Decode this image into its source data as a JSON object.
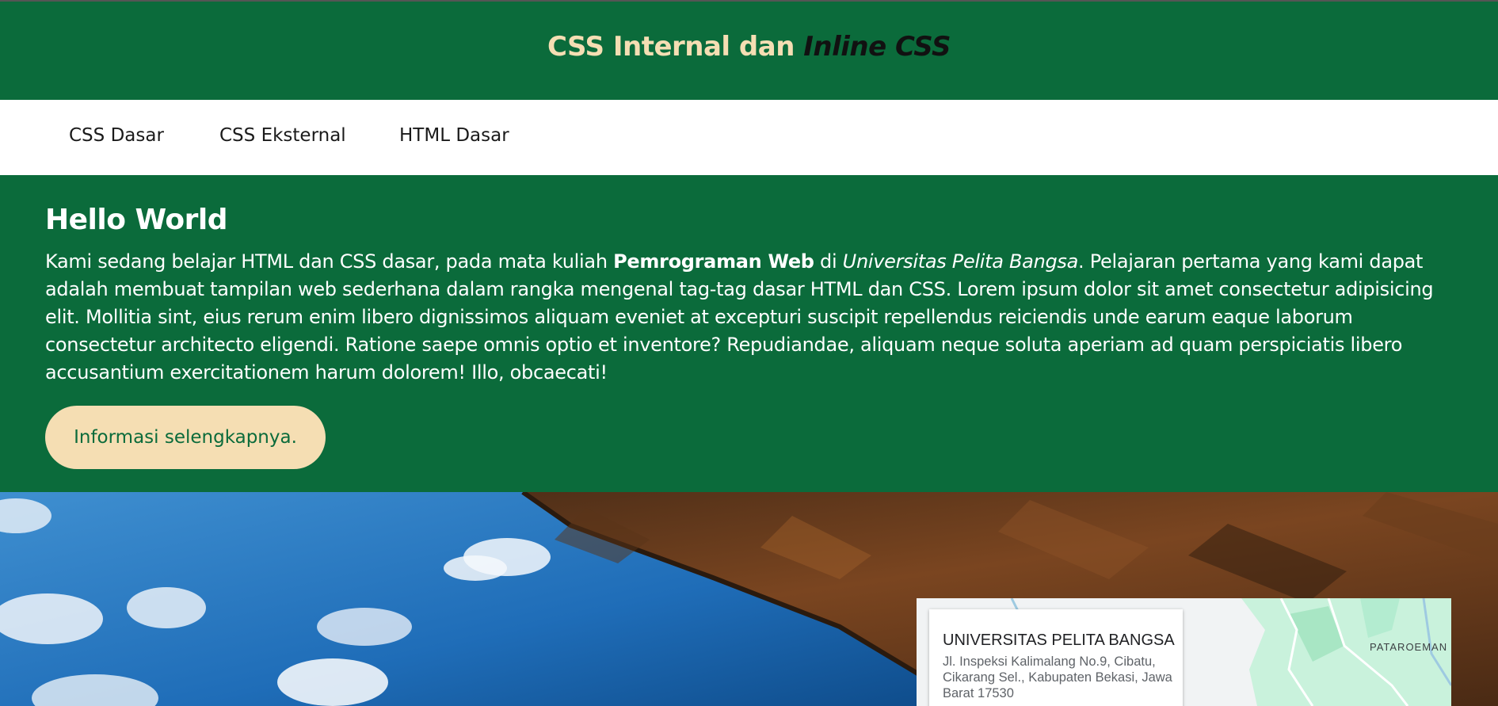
{
  "header": {
    "title_regular": "CSS Internal dan ",
    "title_emphasis": "Inline CSS"
  },
  "nav": {
    "items": [
      {
        "label": "CSS Dasar"
      },
      {
        "label": "CSS Eksternal"
      },
      {
        "label": "HTML Dasar"
      }
    ]
  },
  "hero": {
    "heading": "Hello World",
    "paragraph": {
      "part1": "Kami sedang belajar HTML dan CSS dasar, pada mata kuliah ",
      "bold": "Pemrograman Web",
      "part2": " di ",
      "italic": "Universitas Pelita Bangsa",
      "part3": ". Pelajaran pertama yang kami dapat adalah membuat tampilan web sederhana dalam rangka mengenal tag-tag dasar HTML dan CSS. Lorem ipsum dolor sit amet consectetur adipisicing elit. Mollitia sint, eius rerum enim libero dignissimos aliquam eveniet at excepturi suscipit repellendus reiciendis unde earum eaque laborum consectetur architecto eligendi. Ratione saepe omnis optio et inventore? Repudiandae, aliquam neque soluta aperiam ad quam perspiciatis libero accusantium exercitationem harum dolorem! Illo, obcaecati!"
    },
    "button_label": "Informasi selengkapnya."
  },
  "map": {
    "place_name": "UNIVERSITAS PELITA BANGSA",
    "address": "Jl. Inspeksi Kalimalang No.9, Cibatu, Cikarang Sel., Kabupaten Bekasi, Jawa Barat 17530",
    "area_label": "PATAROEMAN"
  },
  "colors": {
    "primary_green": "#0b6b3b",
    "accent_wheat": "#f5deb3",
    "nav_background": "#ffffff",
    "nav_text": "#1a1a1a"
  }
}
